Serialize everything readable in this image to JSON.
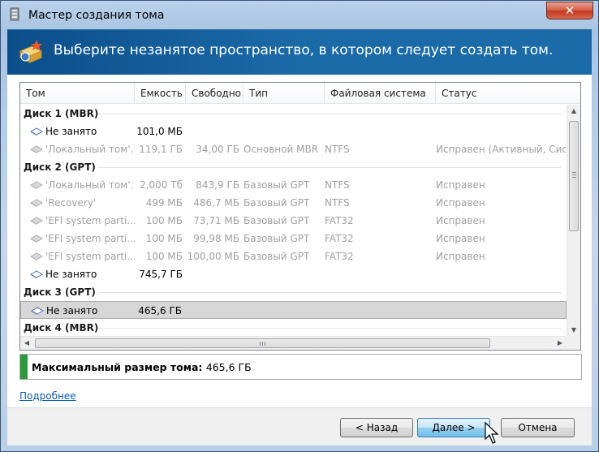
{
  "window": {
    "title": "Мастер создания тома",
    "close_glyph": "✕"
  },
  "header": {
    "text": "Выберите незанятое пространство, в котором следует создать том."
  },
  "columns": [
    "Том",
    "Емкость",
    "Свободно",
    "Тип",
    "Файловая система",
    "Статус"
  ],
  "rows": [
    {
      "kind": "group",
      "label": "Диск 1 (MBR)"
    },
    {
      "kind": "item",
      "state": "normal",
      "name": "Не занято",
      "capacity": "101,0 МБ",
      "free": "",
      "type": "",
      "fs": "",
      "status": ""
    },
    {
      "kind": "item",
      "state": "disabled",
      "name": "'Локальный том'...",
      "capacity": "119,1 ГБ",
      "free": "34,00 ГБ",
      "type": "Основной MBR",
      "fs": "NTFS",
      "status": "Исправен (Активный, Систе"
    },
    {
      "kind": "group",
      "label": "Диск 2 (GPT)"
    },
    {
      "kind": "item",
      "state": "disabled",
      "name": "'Локальный том'...",
      "capacity": "2,000 Тб",
      "free": "843,9 ГБ",
      "type": "Базовый GPT",
      "fs": "NTFS",
      "status": "Исправен"
    },
    {
      "kind": "item",
      "state": "disabled",
      "name": "'Recovery'",
      "capacity": "499 МБ",
      "free": "486,7 МБ",
      "type": "Базовый GPT",
      "fs": "NTFS",
      "status": "Исправен"
    },
    {
      "kind": "item",
      "state": "disabled",
      "name": "'EFI system parti...",
      "capacity": "100 МБ",
      "free": "73,71 МБ",
      "type": "Базовый GPT",
      "fs": "FAT32",
      "status": "Исправен"
    },
    {
      "kind": "item",
      "state": "disabled",
      "name": "'EFI system parti...",
      "capacity": "100 МБ",
      "free": "99,98 МБ",
      "type": "Базовый GPT",
      "fs": "FAT32",
      "status": "Исправен"
    },
    {
      "kind": "item",
      "state": "disabled",
      "name": "'EFI system parti...",
      "capacity": "100 МБ",
      "free": "100,00 МБ",
      "type": "Базовый GPT",
      "fs": "FAT32",
      "status": "Исправен"
    },
    {
      "kind": "item",
      "state": "normal",
      "name": "Не занято",
      "capacity": "745,7 ГБ",
      "free": "",
      "type": "",
      "fs": "",
      "status": ""
    },
    {
      "kind": "group",
      "label": "Диск 3 (GPT)"
    },
    {
      "kind": "item",
      "state": "selected",
      "name": "Не занято",
      "capacity": "465,6 ГБ",
      "free": "",
      "type": "",
      "fs": "",
      "status": ""
    },
    {
      "kind": "group",
      "label": "Диск 4 (MBR)"
    }
  ],
  "max_size": {
    "label": "Максимальный размер тома:",
    "value": "465,6 ГБ"
  },
  "more_link": "Подробнее",
  "buttons": {
    "back": "< Назад",
    "next": "Далее >",
    "cancel": "Отмена"
  },
  "icons": {
    "app": "volume-wizard-icon",
    "header": "new-volume-icon",
    "volume": "disk-volume-icon",
    "scroll_up": "▲",
    "scroll_down": "▼",
    "scroll_left": "◀",
    "scroll_right": "▶"
  },
  "colors": {
    "header_bg": "#1b6aa8",
    "link": "#0b5bb5",
    "max_bar": "#2b9a3a",
    "selected_row": "#d7d7d7"
  }
}
